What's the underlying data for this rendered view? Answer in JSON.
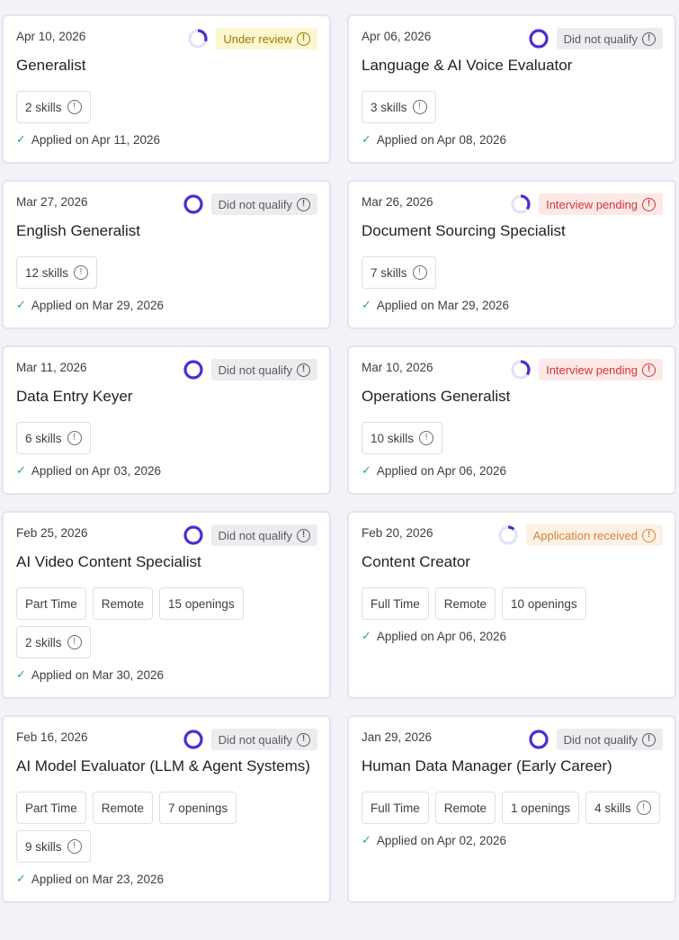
{
  "colors": {
    "ring_accent": "#4f2bd6",
    "ring_track": "#e4e2f8",
    "check": "#33a36a"
  },
  "cards": [
    {
      "date": "Apr 10, 2026",
      "title": "Generalist",
      "status": "Under review",
      "status_type": "review",
      "progress": 0.3,
      "tags": [],
      "skills": "2 skills",
      "applied": "Applied on Apr 11, 2026"
    },
    {
      "date": "Apr 06, 2026",
      "title": "Language & AI Voice Evaluator",
      "status": "Did not qualify",
      "status_type": "dnq",
      "progress": 1.0,
      "tags": [],
      "skills": "3 skills",
      "applied": "Applied on Apr 08, 2026"
    },
    {
      "date": "Mar 27, 2026",
      "title": "English Generalist",
      "status": "Did not qualify",
      "status_type": "dnq",
      "progress": 1.0,
      "tags": [],
      "skills": "12 skills",
      "applied": "Applied on Mar 29, 2026"
    },
    {
      "date": "Mar 26, 2026",
      "title": "Document Sourcing Specialist",
      "status": "Interview pending",
      "status_type": "interview",
      "progress": 0.35,
      "tags": [],
      "skills": "7 skills",
      "applied": "Applied on Mar 29, 2026"
    },
    {
      "date": "Mar 11, 2026",
      "title": "Data Entry Keyer",
      "status": "Did not qualify",
      "status_type": "dnq",
      "progress": 1.0,
      "tags": [],
      "skills": "6 skills",
      "applied": "Applied on Apr 03, 2026"
    },
    {
      "date": "Mar 10, 2026",
      "title": "Operations Generalist",
      "status": "Interview pending",
      "status_type": "interview",
      "progress": 0.35,
      "tags": [],
      "skills": "10 skills",
      "applied": "Applied on Apr 06, 2026"
    },
    {
      "date": "Feb 25, 2026",
      "title": "AI Video Content Specialist",
      "status": "Did not qualify",
      "status_type": "dnq",
      "progress": 1.0,
      "tags": [
        "Part Time",
        "Remote",
        "15 openings"
      ],
      "skills": "2 skills",
      "applied": "Applied on Mar 30, 2026"
    },
    {
      "date": "Feb 20, 2026",
      "title": "Content Creator",
      "status": "Application received",
      "status_type": "received",
      "progress": 0.12,
      "tags": [
        "Full Time",
        "Remote",
        "10 openings"
      ],
      "skills": "",
      "applied": "Applied on Apr 06, 2026"
    },
    {
      "date": "Feb 16, 2026",
      "title": "AI Model Evaluator (LLM & Agent Systems)",
      "status": "Did not qualify",
      "status_type": "dnq",
      "progress": 1.0,
      "tags": [
        "Part Time",
        "Remote",
        "7 openings"
      ],
      "skills": "9 skills",
      "applied": "Applied on Mar 23, 2026"
    },
    {
      "date": "Jan 29, 2026",
      "title": "Human Data Manager (Early Career)",
      "status": "Did not qualify",
      "status_type": "dnq",
      "progress": 1.0,
      "tags": [
        "Full Time",
        "Remote",
        "1 openings"
      ],
      "skills": "4 skills",
      "applied": "Applied on Apr 02, 2026"
    }
  ]
}
